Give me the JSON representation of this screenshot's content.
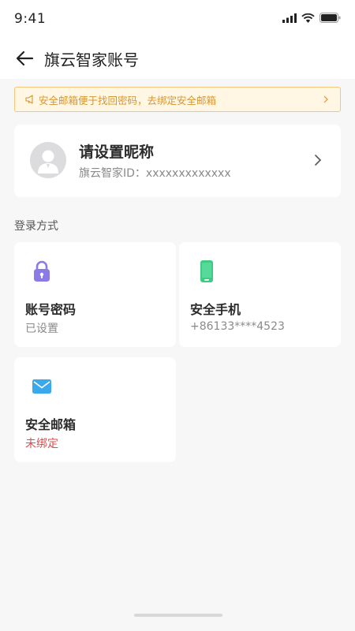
{
  "status_bar": {
    "time": "9:41",
    "icons": [
      "signal-icon",
      "wifi-icon",
      "battery-icon"
    ]
  },
  "header": {
    "title": "旗云智家账号",
    "back_icon": "back-arrow-icon"
  },
  "notice": {
    "text": "安全邮箱便于找回密码，去绑定安全邮箱",
    "icon": "megaphone-icon",
    "color": "#d8952e",
    "background": "#fff7e3"
  },
  "profile": {
    "name": "请设置昵称",
    "id_text": "旗云智家ID：xxxxxxxxxxxxx"
  },
  "login_section": {
    "title": "登录方式",
    "methods": [
      {
        "title": "账号密码",
        "status": "已设置",
        "icon": "lock-icon",
        "icon_color": "#8b7be6"
      },
      {
        "title": "安全手机",
        "status": "+86133****4523",
        "icon": "phone-icon",
        "icon_color": "#3dcc83"
      },
      {
        "title": "安全邮箱",
        "status": "未绑定",
        "icon": "mail-icon",
        "icon_color": "#3aa8ea",
        "status_color": "#e04c4c"
      }
    ]
  }
}
